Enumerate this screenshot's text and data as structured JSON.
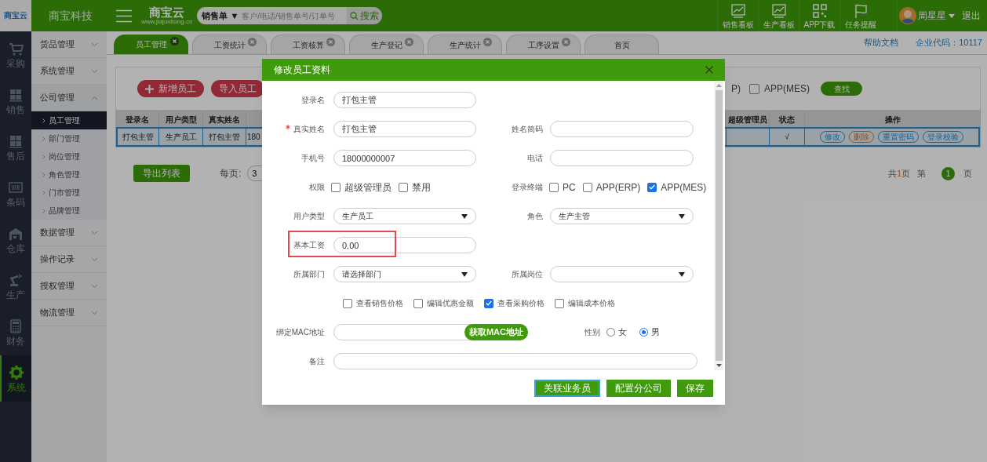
{
  "topbar": {
    "logo": "商宝云",
    "company": "商宝科技",
    "brand": {
      "name": "商宝云",
      "url": "www.jiajuxitong.cn"
    },
    "search": {
      "scope": "销售单 ▼",
      "placeholder": "客户/电话/销售单号/订单号",
      "button": "搜索"
    },
    "shortcuts": [
      {
        "kind": "chart",
        "label": "销售看板"
      },
      {
        "kind": "chart",
        "label": "生产看板"
      },
      {
        "kind": "qr",
        "label": "APP下载"
      },
      {
        "kind": "flag",
        "label": "任务提醒"
      }
    ],
    "user": {
      "name": "周星星",
      "logout": "退出"
    }
  },
  "rail": [
    {
      "kind": "cart",
      "label": "采购",
      "selected": false
    },
    {
      "kind": "boxes",
      "label": "销售",
      "selected": false
    },
    {
      "kind": "boxes",
      "label": "售后",
      "selected": false
    },
    {
      "kind": "barcode",
      "label": "条码",
      "selected": false
    },
    {
      "kind": "warehouse",
      "label": "仓库",
      "selected": false
    },
    {
      "kind": "robot",
      "label": "生产",
      "selected": false
    },
    {
      "kind": "calculator",
      "label": "财务",
      "selected": false
    },
    {
      "kind": "gear",
      "label": "系统",
      "selected": true
    }
  ],
  "sidebar": [
    {
      "label": "货品管理",
      "expanded": false
    },
    {
      "label": "系统管理",
      "expanded": false
    },
    {
      "label": "公司管理",
      "expanded": true,
      "children": [
        {
          "label": "员工管理",
          "selected": true
        },
        {
          "label": "部门管理",
          "selected": false
        },
        {
          "label": "岗位管理",
          "selected": false
        },
        {
          "label": "角色管理",
          "selected": false
        },
        {
          "label": "门市管理",
          "selected": false
        },
        {
          "label": "品牌管理",
          "selected": false
        }
      ]
    },
    {
      "label": "数据管理",
      "expanded": false
    },
    {
      "label": "操作记录",
      "expanded": false
    },
    {
      "label": "授权管理",
      "expanded": false
    },
    {
      "label": "物流管理",
      "expanded": false
    }
  ],
  "tabs": [
    {
      "label": "员工管理",
      "selected": true,
      "closable": true
    },
    {
      "label": "工资统计",
      "selected": false,
      "closable": true
    },
    {
      "label": "工资核算",
      "selected": false,
      "closable": true
    },
    {
      "label": "生产登记",
      "selected": false,
      "closable": true
    },
    {
      "label": "生产统计",
      "selected": false,
      "closable": true
    },
    {
      "label": "工序设置",
      "selected": false,
      "closable": true
    },
    {
      "label": "首页",
      "selected": false,
      "closable": false
    }
  ],
  "links": {
    "help": "帮助文档",
    "company_code": "企业代码：10117"
  },
  "toolbar": {
    "buttons": [
      {
        "kind": "add",
        "label": "新增员工"
      },
      {
        "kind": "import",
        "label": "导入员工"
      }
    ],
    "terminal_tail": "P)",
    "terminal_option": {
      "label": "APP(MES)",
      "checked": false
    },
    "find": "查找"
  },
  "table": {
    "columns_left": [
      "登录名",
      "用户类型",
      "真实姓名"
    ],
    "columns_right": [
      "超级管理员",
      "状态",
      "操作"
    ],
    "rows": [
      {
        "selected": true,
        "login": "打包主管",
        "user_type": "生产员工",
        "real_name": "打包主管",
        "phone": "180",
        "status": "√",
        "actions": [
          {
            "kind": "edit",
            "label": "修改"
          },
          {
            "kind": "delete",
            "label": "删除"
          },
          {
            "kind": "reset",
            "label": "重置密码"
          },
          {
            "kind": "verify",
            "label": "登录校验"
          }
        ]
      }
    ]
  },
  "list_footer": {
    "export": "导出列表",
    "per_page": "每页:",
    "per_page_value": "3",
    "total_prefix": "共",
    "total_pages": "1",
    "total_suffix": "页",
    "page_prefix": "第",
    "current": "1",
    "page_suffix": "页"
  },
  "modal": {
    "title": "修改员工资料",
    "rows": [
      {
        "fields": [
          {
            "kind": "text",
            "label": "登录名",
            "value": "打包主管"
          }
        ]
      },
      {
        "fields": [
          {
            "kind": "text",
            "label": "真实姓名",
            "value": "打包主管",
            "required": true
          },
          {
            "kind": "text",
            "label": "姓名简码"
          }
        ]
      },
      {
        "fields": [
          {
            "kind": "text",
            "label": "手机号",
            "value": "18000000007"
          },
          {
            "kind": "text",
            "label": "电话"
          }
        ]
      },
      {
        "fields": [
          {
            "kind": "checks",
            "label": "权限",
            "options": [
              {
                "label": "超级管理员",
                "checked": false
              },
              {
                "label": "禁用",
                "checked": false
              }
            ]
          },
          {
            "kind": "checks",
            "label": "登录终端",
            "options": [
              {
                "label": "PC",
                "checked": false
              },
              {
                "label": "APP(ERP)",
                "checked": false
              },
              {
                "label": "APP(MES)",
                "checked": true
              }
            ]
          }
        ]
      },
      {
        "fields": [
          {
            "kind": "select",
            "label": "用户类型",
            "value": "生产员工"
          },
          {
            "kind": "select",
            "label": "角色",
            "value": "生产主管"
          }
        ]
      },
      {
        "fields": [
          {
            "kind": "text",
            "label": "基本工资",
            "value": "0.00",
            "highlighted": true
          }
        ]
      },
      {
        "fields": [
          {
            "kind": "select",
            "label": "所属部门",
            "value": "请选择部门"
          },
          {
            "kind": "select",
            "label": "所属岗位"
          }
        ]
      },
      {
        "fields": [
          {
            "kind": "checks",
            "options": [
              {
                "label": "查看销售价格",
                "checked": false
              },
              {
                "label": "编辑优惠金额",
                "checked": false
              },
              {
                "label": "查看采购价格",
                "checked": true
              },
              {
                "label": "编辑成本价格",
                "checked": false
              }
            ]
          }
        ]
      },
      {
        "fields": [
          {
            "kind": "mac",
            "label": "绑定MAC地址",
            "button": "获取MAC地址"
          },
          {
            "kind": "radios",
            "label": "性别",
            "options": [
              {
                "label": "女",
                "selected": false
              },
              {
                "label": "男",
                "selected": true
              }
            ]
          }
        ]
      },
      {
        "fields": [
          {
            "kind": "wide",
            "label": "备注"
          }
        ]
      }
    ],
    "buttons": [
      {
        "label": "关联业务员",
        "focused": true
      },
      {
        "label": "配置分公司",
        "focused": false
      },
      {
        "label": "保存",
        "focused": false
      }
    ]
  }
}
